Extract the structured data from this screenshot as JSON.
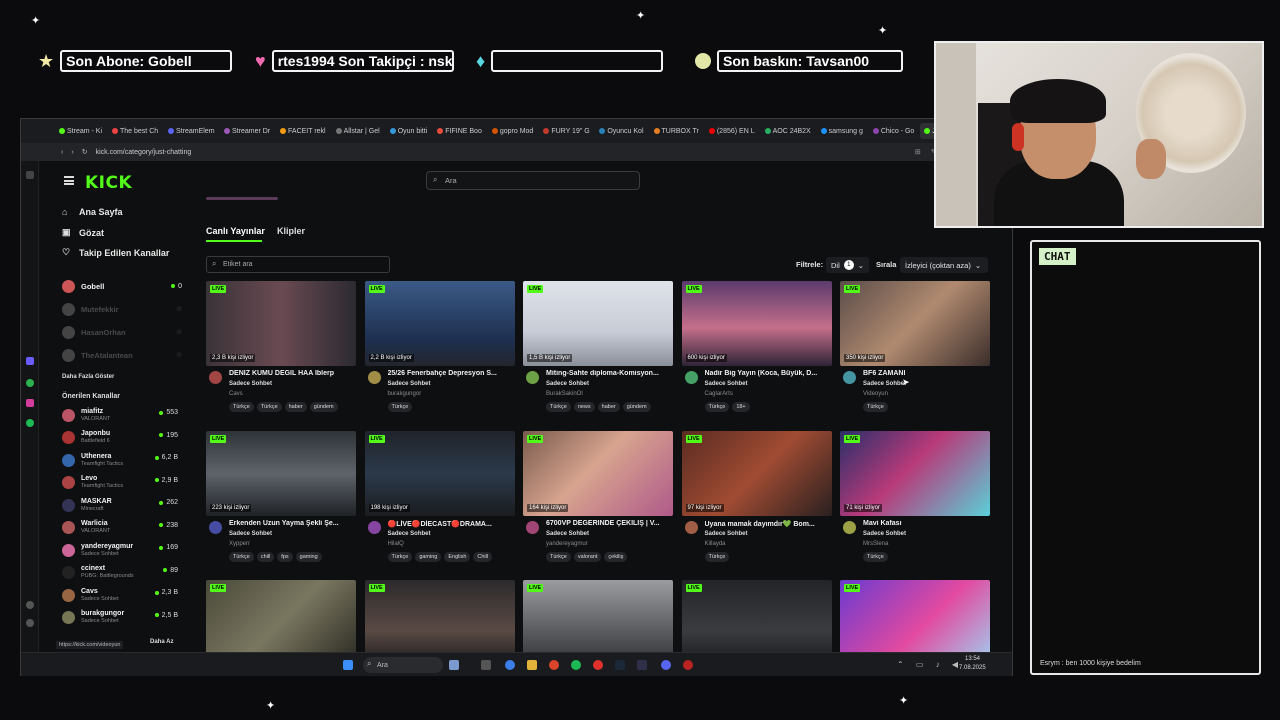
{
  "overlay": {
    "last_sub": "Son Abone: Gobell",
    "last_follow": "rtes1994   Son Takipçi : nsk",
    "empty_box": "",
    "last_raid": "Son baskın: Tavsan00"
  },
  "browser": {
    "tabs": [
      "Stream - Ki",
      "The best Ch",
      "StreamElem",
      "Streamer Dr",
      "FACEIT rekl",
      "Allstar | Gel",
      "Oyun bitti",
      "FIFINE Boo",
      "gopro Mod",
      "FURY 19\" G",
      "Oyuncu Kol",
      "TURBOX Tr",
      "(2856) EN L",
      "AOC 24B2X",
      "samsung g",
      "Chico - Go",
      "Just Chatting Strea"
    ],
    "url": "kick.com/category/just-chatting",
    "new_tab": "+"
  },
  "kick": {
    "logo": "KICK",
    "search_placeholder": "Ara",
    "nav": [
      {
        "label": "Ana Sayfa",
        "icon": "⌂"
      },
      {
        "label": "Gözat",
        "icon": "▣"
      },
      {
        "label": "Takip Edilen Kanallar",
        "icon": "♡"
      }
    ],
    "followed": [
      {
        "name": "Gobell",
        "count": "0",
        "online": true,
        "color": "#c55"
      },
      {
        "name": "Mutefekkir",
        "count": "",
        "online": false,
        "color": "#444"
      },
      {
        "name": "HasanOrhan",
        "count": "",
        "online": false,
        "color": "#444"
      },
      {
        "name": "TheAtalantean",
        "count": "",
        "online": false,
        "color": "#444"
      }
    ],
    "show_more": "Daha Fazla Göster",
    "recommended_title": "Önerilen Kanallar",
    "recommended": [
      {
        "name": "miafitz",
        "game": "VALORANT",
        "count": "553",
        "color": "#b56"
      },
      {
        "name": "Japonbu",
        "game": "Battlefield 6",
        "count": "195",
        "color": "#a33"
      },
      {
        "name": "Uthenera",
        "game": "Teamfight Tactics",
        "count": "6,2 B",
        "color": "#36a"
      },
      {
        "name": "Levo",
        "game": "Teamfight Tactics",
        "count": "2,9 B",
        "color": "#a44"
      },
      {
        "name": "MASKAR",
        "game": "Minecraft",
        "count": "262",
        "color": "#335"
      },
      {
        "name": "Warlicia",
        "game": "VALORANT",
        "count": "238",
        "color": "#a55"
      },
      {
        "name": "yandereyagmur",
        "game": "Sadece Sohbet",
        "count": "169",
        "color": "#c69"
      },
      {
        "name": "ccinext",
        "game": "PUBG: Battlegrounds",
        "count": "89",
        "color": "#222"
      },
      {
        "name": "Cavs",
        "game": "Sadece Sohbet",
        "count": "2,3 B",
        "color": "#964"
      },
      {
        "name": "burakgungor",
        "game": "Sadece Sohbet",
        "count": "2,5 B",
        "color": "#775"
      }
    ],
    "less": "Daha Az",
    "status_url": "https://kick.com/videoyun",
    "tab_live": "Canlı Yayınlar",
    "tab_clips": "Klipler",
    "tag_search": "Etiket ara",
    "filter_label": "Filtrele:",
    "lang_label": "Dil",
    "lang_count": "1",
    "sort_label": "Sırala",
    "sort_value": "İzleyici (çoktan aza)",
    "live_badge": "LIVE",
    "cards": [
      {
        "viewers": "2,3 B kişi izliyor",
        "title": "DENİZ KUMU DEĞİL HAA İblerp",
        "category": "Sadece Sohbet",
        "user": "Cavs",
        "tags": [
          "Türkçe",
          "Türkçe",
          "haber",
          "gündem"
        ],
        "bg": "linear-gradient(90deg,#3a3338,#6a4a52 50%,#2c2a31)"
      },
      {
        "viewers": "2,2 B kişi izliyor",
        "title": "25/26 Fenerbahçe Depresyon S...",
        "category": "Sadece Sohbet",
        "user": "burakgungor",
        "tags": [
          "Türkçe"
        ],
        "bg": "linear-gradient(180deg,#3a5a86,#1e2f4f 70%,#23262c)"
      },
      {
        "viewers": "1,5 B kişi izliyor",
        "title": "Miting-Sahte diploma-Komisyon...",
        "category": "Sadece Sohbet",
        "user": "BurakSakinOl",
        "tags": [
          "Türkçe",
          "news",
          "haber",
          "gündem"
        ],
        "bg": "linear-gradient(180deg,#dfe3ea,#c7ccd6 60%,#8a8f99)"
      },
      {
        "viewers": "600 kişi izliyor",
        "title": "Nadir Big Yayın (Koca, Büyük, D...",
        "category": "Sadece Sohbet",
        "user": "CaglarArts",
        "tags": [
          "Türkçe",
          "18+"
        ],
        "bg": "linear-gradient(180deg,#5b3a6d,#c56f8b 55%,#2f2436)"
      },
      {
        "viewers": "350 kişi izliyor",
        "title": "BF6 ZAMANI",
        "category": "Sadece Sohbet",
        "user": "Videoyun",
        "tags": [
          "Türkçe"
        ],
        "bg": "linear-gradient(135deg,#5b4d4a,#b08a6f 50%,#3b2e2b)"
      },
      {
        "viewers": "223 kişi izliyor",
        "title": "Erkenden Uzun Yayma Şekli Şe...",
        "category": "Sadece Sohbet",
        "user": "Xypperr",
        "tags": [
          "Türkçe",
          "chill",
          "fps",
          "gaming"
        ],
        "bg": "linear-gradient(180deg,#2f3338,#5e646b 50%,#1f2226)"
      },
      {
        "viewers": "198 kişi izliyor",
        "title": "🔴LİVE🔴DİECAST🔴DRAMA...",
        "category": "Sadece Sohbet",
        "user": "HilalQ",
        "tags": [
          "Türkçe",
          "gaming",
          "English",
          "Chill"
        ],
        "bg": "linear-gradient(180deg,#20232a,#2c3a4a 50%,#1a1c20)"
      },
      {
        "viewers": "164 kişi izliyor",
        "title": "6700VP DEĞERİNDE ÇEKİLİŞ | V...",
        "category": "Sadece Sohbet",
        "user": "yandereyagmur",
        "tags": [
          "Türkçe",
          "valorant",
          "çekiliş"
        ],
        "bg": "linear-gradient(135deg,#7a5a4e,#d7a48e 45%,#b05a8a)"
      },
      {
        "viewers": "97 kişi izliyor",
        "title": "Uyana mamak dayımdır💚 Bom...",
        "category": "Sadece Sohbet",
        "user": "Killayda",
        "tags": [
          "Türkçe"
        ],
        "bg": "linear-gradient(135deg,#5a2c22,#a04b32 50%,#2a2020)"
      },
      {
        "viewers": "71 kişi izliyor",
        "title": "Mavi Kafası",
        "category": "Sadece Sohbet",
        "user": "MrsSlena",
        "tags": [
          "Türkçe"
        ],
        "bg": "linear-gradient(135deg,#2a2f6a,#b83a7a 45%,#5ad0d8)"
      },
      {
        "viewers": "",
        "title": "",
        "category": "",
        "user": "",
        "tags": [],
        "bg": "linear-gradient(135deg,#4a4a3a,#7a7760 50%,#2b2a22)"
      },
      {
        "viewers": "",
        "title": "",
        "category": "",
        "user": "",
        "tags": [],
        "bg": "linear-gradient(180deg,#2c2a2c,#5a4a44 60%,#1c1a1c)"
      },
      {
        "viewers": "",
        "title": "",
        "category": "",
        "user": "",
        "tags": [],
        "bg": "linear-gradient(180deg,#9a9ca0,#5a5c60 60%,#303236)"
      },
      {
        "viewers": "",
        "title": "",
        "category": "",
        "user": "",
        "tags": [],
        "bg": "linear-gradient(180deg,#222428,#3a3c40 60%,#18191c)"
      },
      {
        "viewers": "",
        "title": "",
        "category": "",
        "user": "",
        "tags": [],
        "bg": "linear-gradient(135deg,#6a3ad0,#e24aa0 55%,#a0d0f0)"
      }
    ]
  },
  "taskbar": {
    "search": "Ara",
    "time": "13:54",
    "date": "7.08.2025"
  },
  "chat": {
    "label": "CHAT",
    "message": "Esrym : ben 1000 kişiye bedelim"
  }
}
